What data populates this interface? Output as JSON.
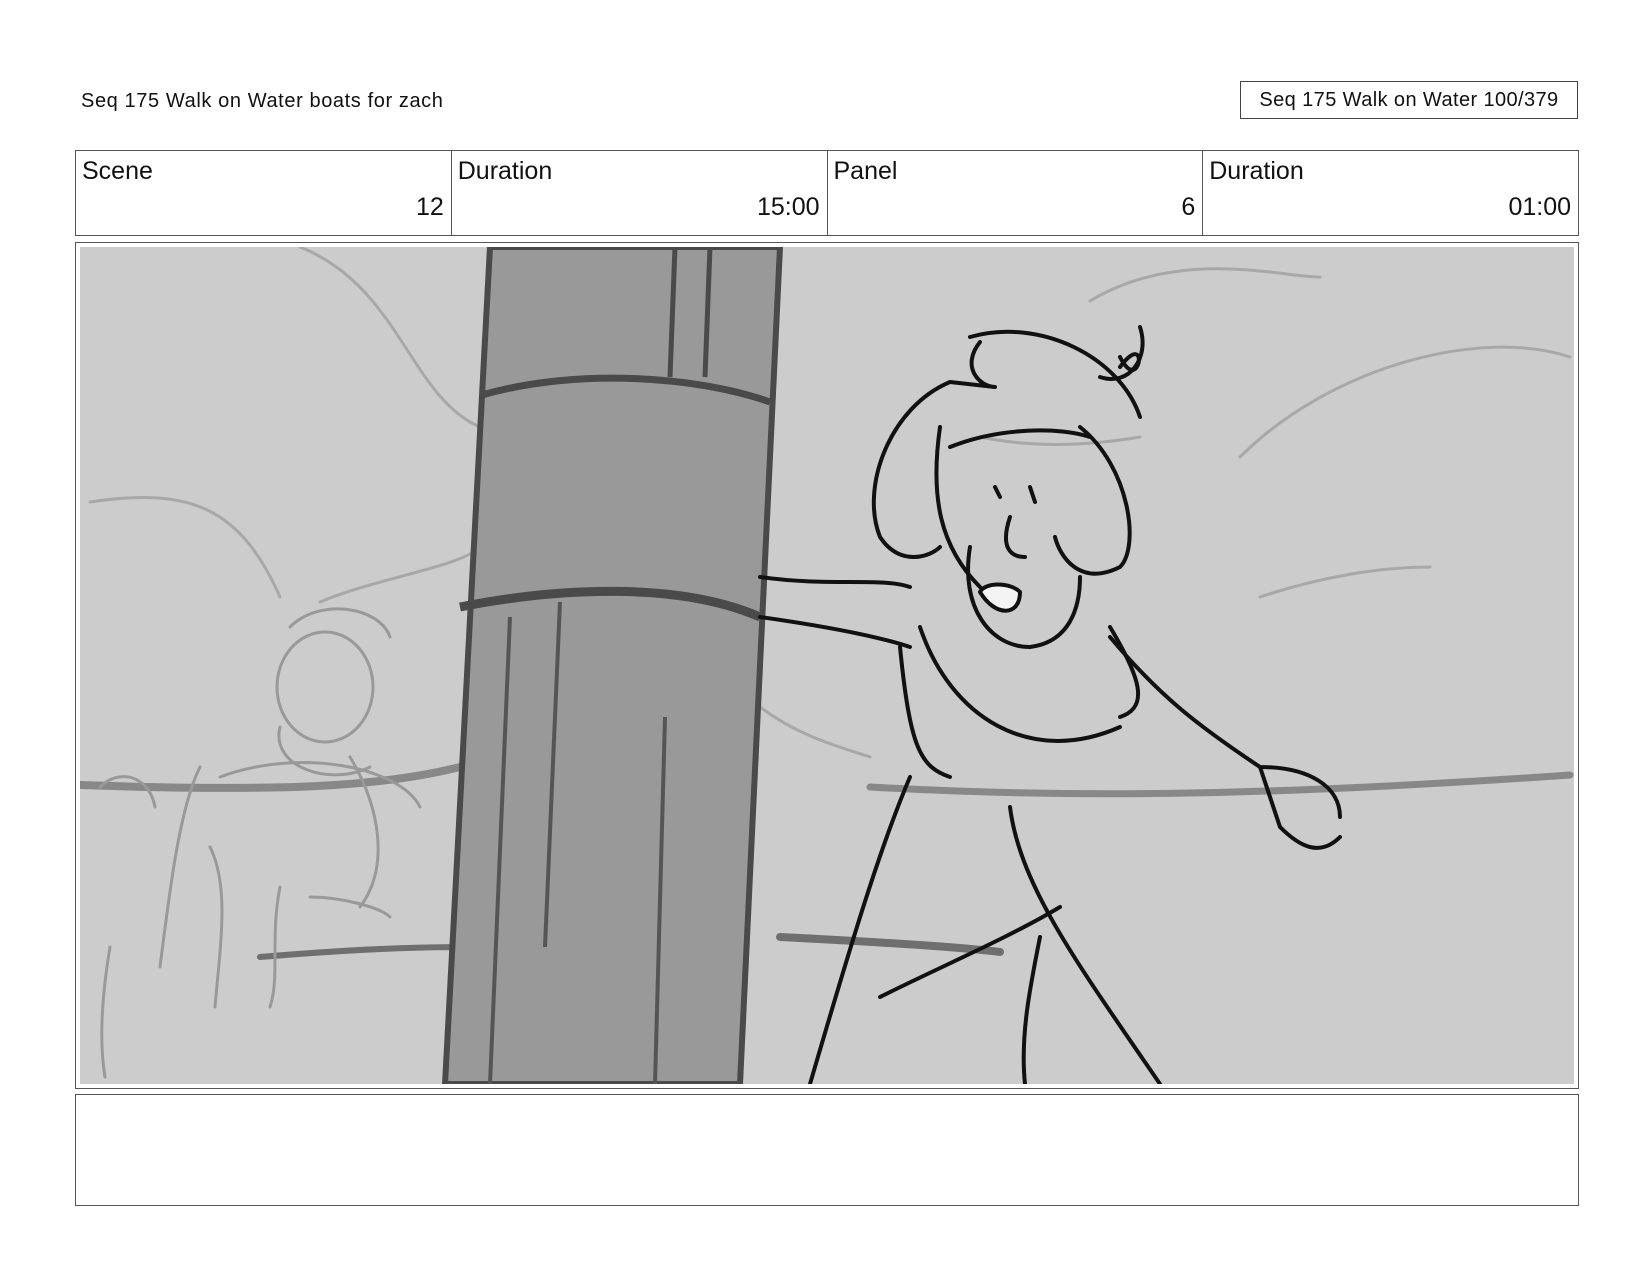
{
  "header": {
    "sequence_title": "Seq 175 Walk on Water  boats for zach",
    "page_label": "Seq 175 Walk on Water 100/379"
  },
  "info": {
    "scene_label": "Scene",
    "scene_value": "12",
    "scene_duration_label": "Duration",
    "scene_duration_value": "15:00",
    "panel_label": "Panel",
    "panel_value": "6",
    "panel_duration_label": "Duration",
    "panel_duration_value": "01:00"
  },
  "panel": {
    "background_color": "#cccccc",
    "pillar_color": "#999999"
  },
  "notes": {
    "text": ""
  }
}
